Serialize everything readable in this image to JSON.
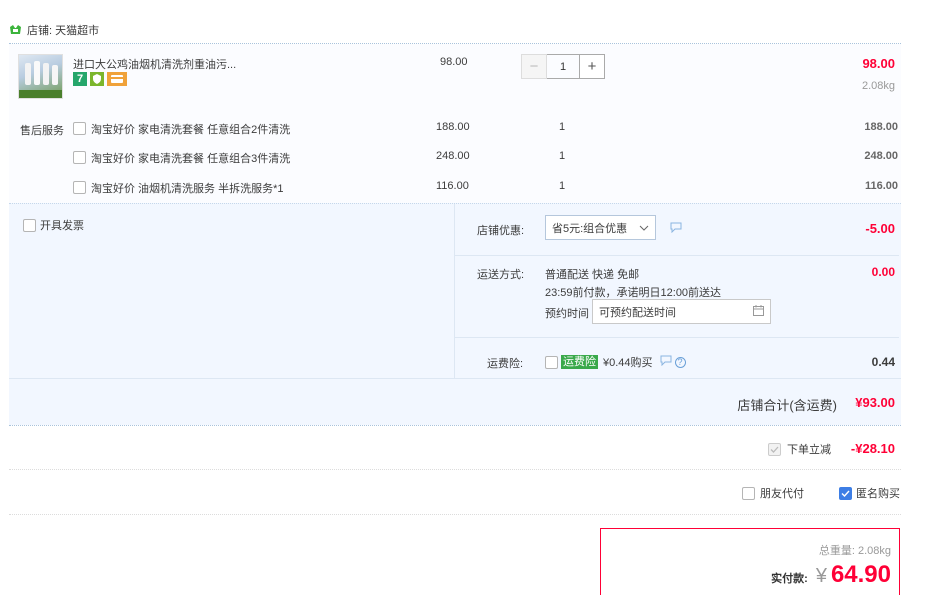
{
  "shop": {
    "label": "店铺: 天猫超市"
  },
  "product": {
    "title": "进口大公鸡油烟机清洗剂重油污...",
    "unit_price": "98.00",
    "quantity": "1",
    "subtotal": "98.00",
    "weight": "2.08kg"
  },
  "service": {
    "label": "售后服务",
    "items": [
      {
        "name": "淘宝好价 家电清洗套餐 任意组合2件清洗",
        "price": "188.00",
        "qty": "1",
        "total": "188.00"
      },
      {
        "name": "淘宝好价 家电清洗套餐 任意组合3件清洗",
        "price": "248.00",
        "qty": "1",
        "total": "248.00"
      },
      {
        "name": "淘宝好价 油烟机清洗服务 半拆洗服务*1",
        "price": "116.00",
        "qty": "1",
        "total": "116.00"
      }
    ]
  },
  "invoice": {
    "label": "开具发票"
  },
  "discount": {
    "label": "店铺优惠:",
    "selected": "省5元:组合优惠",
    "amount": "-5.00"
  },
  "delivery": {
    "label": "运送方式:",
    "method": "普通配送 快递 免邮",
    "promise": "23:59前付款，承诺明日12:00前送达",
    "appoint_label": "预约时间",
    "appoint_placeholder": "可预约配送时间",
    "amount": "0.00"
  },
  "insurance": {
    "label": "运费险:",
    "badge": "运费险",
    "price": "¥0.44购买",
    "amount": "0.44"
  },
  "shop_total": {
    "label": "店铺合计(含运费)",
    "amount": "¥93.00"
  },
  "instant_discount": {
    "label": "下单立减",
    "amount": "-¥28.10"
  },
  "options": {
    "friend_pay": "朋友代付",
    "anonymous": "匿名购买"
  },
  "summary": {
    "weight_label": "总重量:",
    "weight": "2.08kg",
    "pay_label": "实付款:",
    "currency": "¥",
    "amount": "64.90"
  },
  "colors": {
    "accent_red": "#ff0036",
    "price_red": "#f40",
    "panel_bg": "#f2f7ff",
    "checkbox_blue": "#3d7ee5"
  }
}
